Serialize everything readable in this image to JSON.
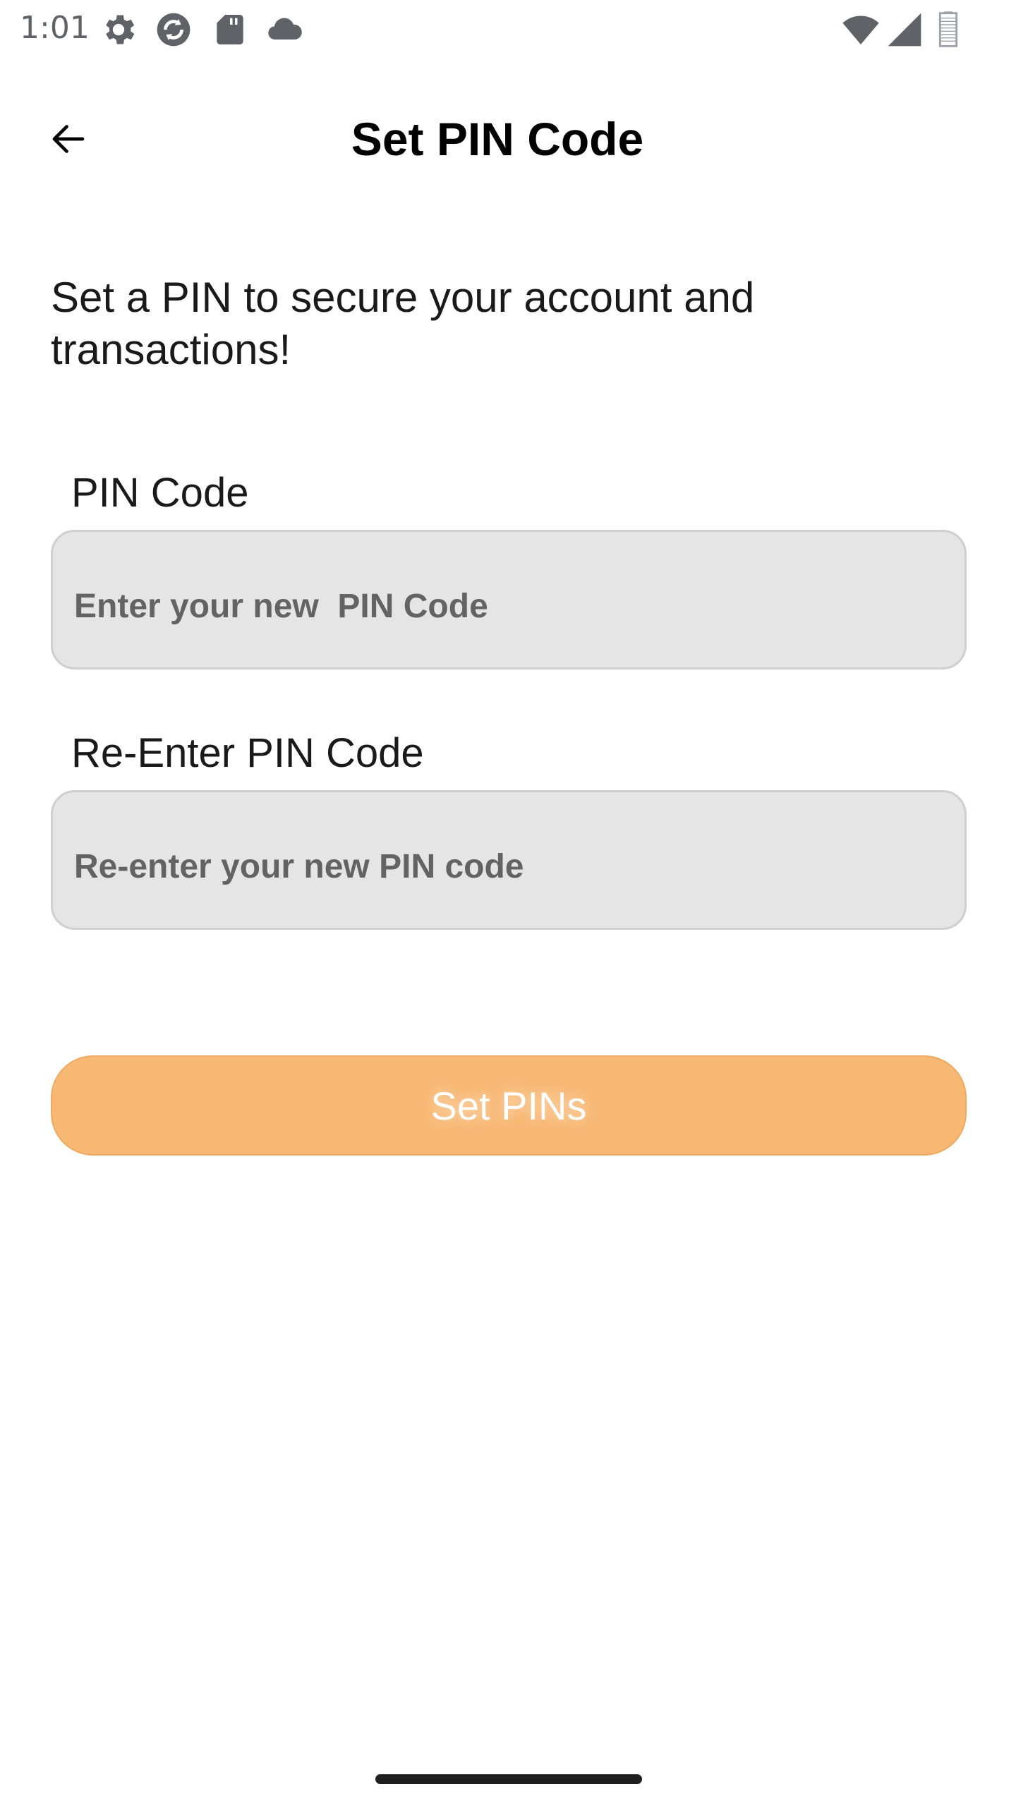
{
  "status_bar": {
    "time": "1:01",
    "icons_left": [
      "settings-gear-icon",
      "sync-icon",
      "sd-card-icon",
      "cloud-icon"
    ],
    "icons_right": [
      "wifi-icon",
      "cellular-signal-icon",
      "battery-icon"
    ]
  },
  "header": {
    "back_icon": "arrow-left-icon",
    "title": "Set PIN Code"
  },
  "intro": {
    "text": "Set a PIN to secure your account and transactions!"
  },
  "form": {
    "pin": {
      "label": "PIN Code",
      "value": "",
      "placeholder": "Enter your new  PIN Code"
    },
    "confirm_pin": {
      "label": "Re-Enter PIN Code",
      "value": "",
      "placeholder": "Re-enter your new PIN code"
    },
    "submit_label": "Set PINs"
  },
  "colors": {
    "accent": "#f7b874",
    "field_background": "#e5e5e5",
    "field_border": "#cfcfcf",
    "placeholder": "#636363"
  }
}
